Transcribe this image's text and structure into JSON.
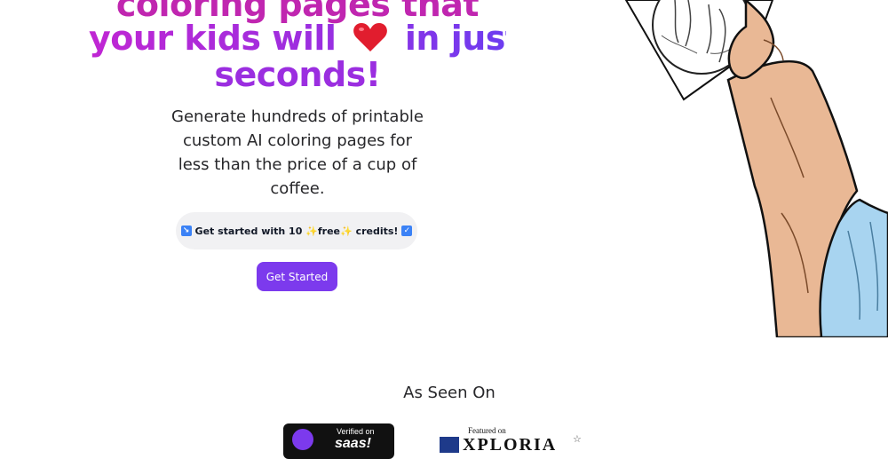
{
  "hero": {
    "title_line1": "coloring pages that",
    "title_line2_before": "your kids will",
    "title_heart": "heart-emoji",
    "title_line2_after": "in just",
    "title_line3": "seconds!",
    "subtitle": "Generate hundreds of printable custom AI coloring pages for less than the price of a cup of coffee.",
    "colors": {
      "pink": "#c026b0",
      "purple": "#9b2ee0",
      "violet": "#6d3cf0"
    }
  },
  "promo": {
    "arrow_icon": "arrow-down-right-icon",
    "text_before": "Get started with 10",
    "sparkle_icon": "sparkles-emoji",
    "free_word": "free",
    "text_after": "credits!",
    "check_icon": "check-box-icon"
  },
  "cta": {
    "label": "Get Started",
    "color": "#7c3aed"
  },
  "seen_on": {
    "heading": "As Seen On",
    "badges": [
      {
        "small": "Verified on",
        "big": "saas!"
      },
      {
        "small": "Featured on",
        "big": "XPLORIA"
      }
    ]
  },
  "illustration": {
    "icon": "hand-holding-coloring-page-illustration"
  }
}
